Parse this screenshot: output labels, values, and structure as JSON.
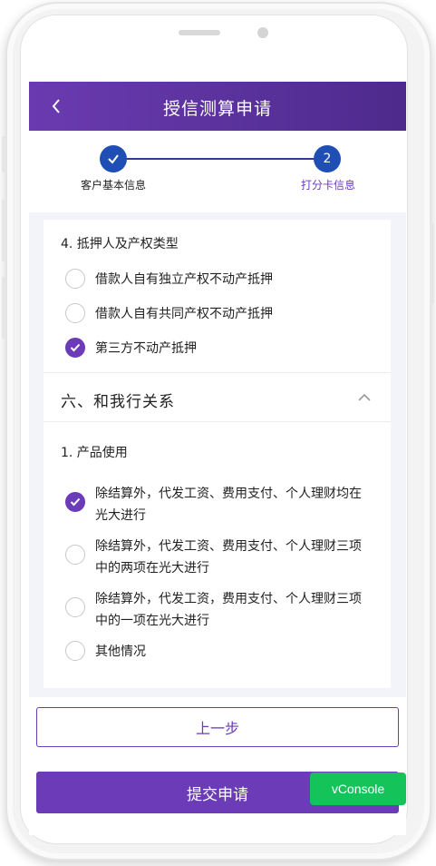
{
  "header": {
    "title": "授信测算申请",
    "back_icon": "chevron-left-icon"
  },
  "steps": [
    {
      "number": "✓",
      "label": "客户基本信息",
      "state": "done"
    },
    {
      "number": "2",
      "label": "打分卡信息",
      "state": "active"
    }
  ],
  "question4": {
    "title": "4. 抵押人及产权类型",
    "options": [
      {
        "label": "借款人自有独立产权不动产抵押",
        "checked": false
      },
      {
        "label": "借款人自有共同产权不动产抵押",
        "checked": false
      },
      {
        "label": "第三方不动产抵押",
        "checked": true
      }
    ]
  },
  "section6": {
    "title": "六、和我行关系",
    "toggle_icon": "chevron-up-icon"
  },
  "question1": {
    "title": "1. 产品使用",
    "options": [
      {
        "label": "除结算外，代发工资、费用支付、个人理财均在光大进行",
        "checked": true
      },
      {
        "label": "除结算外，代发工资、费用支付、个人理财三项中的两项在光大进行",
        "checked": false
      },
      {
        "label": "除结算外，代发工资，费用支付、个人理财三项中的一项在光大进行",
        "checked": false
      },
      {
        "label": "其他情况",
        "checked": false
      }
    ]
  },
  "buttons": {
    "prev_label": "上一步",
    "submit_label": "提交申请"
  },
  "vconsole": {
    "label": "vConsole"
  },
  "colors": {
    "accent": "#6b3bb8",
    "step_blue": "#1f4fb5",
    "vconsole_green": "#15c35b"
  }
}
